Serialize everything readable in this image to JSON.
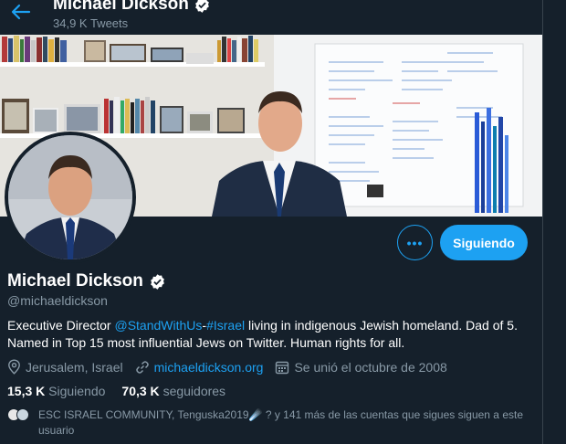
{
  "header": {
    "name": "Michael Dickson",
    "tweet_count": "34,9 K Tweets"
  },
  "profile": {
    "name": "Michael Dickson",
    "handle": "@michaeldickson",
    "bio": {
      "part1": "Executive Director ",
      "mention": "@StandWithUs",
      "dash": "-",
      "hashtag": "#Israel",
      "part2": " living in indigenous Jewish homeland. Dad of 5. Named in Top 15 most influential Jews on Twitter. Human rights for all."
    },
    "location": "Jerusalem, Israel",
    "website": "michaeldickson.org",
    "joined": "Se unió el octubre de 2008"
  },
  "actions": {
    "more_label": "•••",
    "follow_label": "Siguiendo"
  },
  "stats": {
    "following_count": "15,3 K",
    "following_label": "Siguiendo",
    "followers_count": "70,3 K",
    "followers_label": "seguidores"
  },
  "followers_you_know": {
    "text": "ESC ISRAEL COMMUNITY, Tenguska2019☄️ ? y 141 más de las cuentas que sigues siguen a este usuario"
  },
  "colors": {
    "background": "#15202b",
    "accent": "#1da1f2",
    "secondary_text": "#8899a6"
  }
}
